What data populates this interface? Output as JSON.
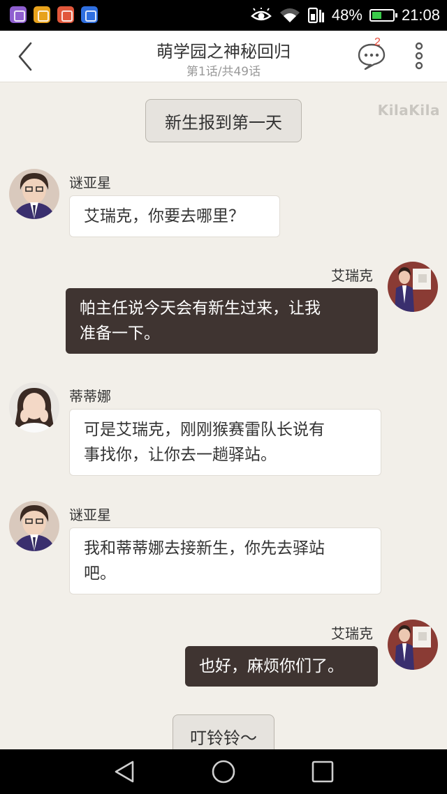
{
  "status_bar": {
    "battery": "48%",
    "battery_level": 0.48,
    "time": "21:08"
  },
  "header": {
    "title": "萌学园之神秘回归",
    "subtitle": "第1话/共49话",
    "comment_count": "2"
  },
  "watermark": "KilaKila",
  "scenes": [
    "新生报到第一天",
    "叮铃铃～"
  ],
  "messages": [
    {
      "speaker": "谜亚星",
      "side": "left",
      "lines": [
        "艾瑞克，你要去哪里？"
      ]
    },
    {
      "speaker": "艾瑞克",
      "side": "right",
      "lines": [
        "帕主任说今天会有新生过来，让我",
        "准备一下。"
      ]
    },
    {
      "speaker": "蒂蒂娜",
      "side": "left",
      "lines": [
        "可是艾瑞克，刚刚猴赛雷队长说有",
        "事找你，让你去一趟驿站。"
      ]
    },
    {
      "speaker": "谜亚星",
      "side": "left",
      "lines": [
        "我和蒂蒂娜去接新生，你先去驿站",
        "吧。"
      ]
    },
    {
      "speaker": "艾瑞克",
      "side": "right",
      "lines": [
        "也好，麻烦你们了。"
      ]
    }
  ],
  "colors": {
    "background": "#f2efe9",
    "right_bubble": "#3f3431",
    "badge": "#e84b3a"
  }
}
